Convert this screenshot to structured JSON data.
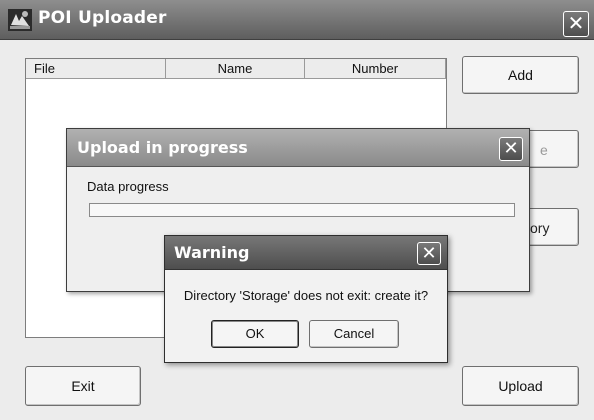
{
  "main_window": {
    "title": "POI Uploader",
    "icon": "poi-app-icon",
    "close_icon": "close-icon"
  },
  "file_list": {
    "columns": [
      "File",
      "Name",
      "Number"
    ]
  },
  "buttons": {
    "add": "Add",
    "partial_2": "e",
    "partial_3": "ory",
    "exit": "Exit",
    "upload": "Upload"
  },
  "progress_dialog": {
    "title": "Upload in progress",
    "label": "Data progress",
    "progress": 0
  },
  "warning_dialog": {
    "title": "Warning",
    "message": "Directory 'Storage' does not exit: create it?",
    "ok": "OK",
    "cancel": "Cancel"
  },
  "colors": {
    "titlebar_main": "#5e5e5e",
    "titlebar_inactive": "#8a8a8a",
    "window_bg": "#ececec"
  }
}
